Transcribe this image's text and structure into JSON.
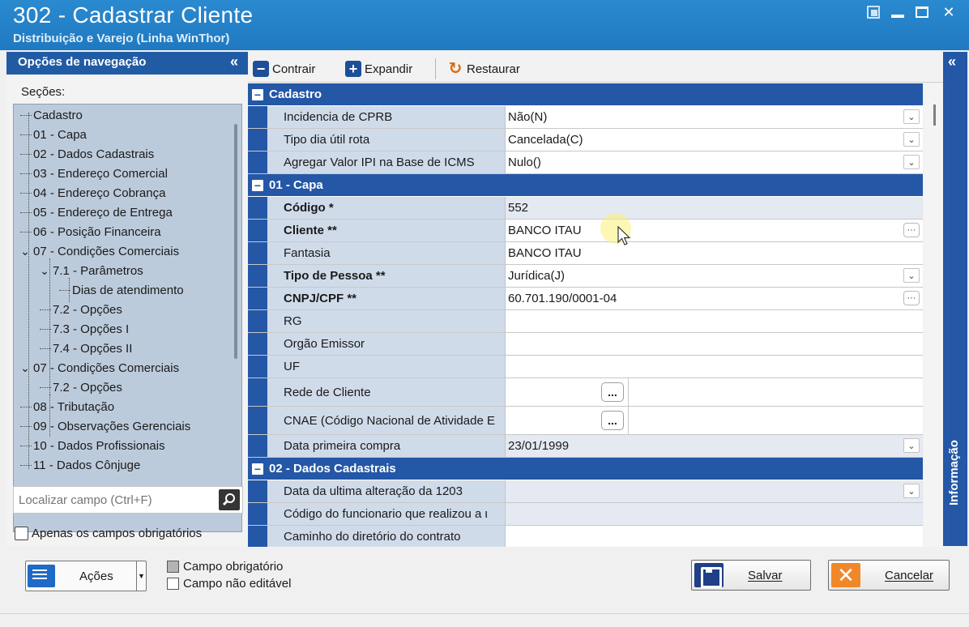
{
  "window": {
    "title": "302 - Cadastrar Cliente",
    "subtitle": "Distribuição e Varejo (Linha WinThor)"
  },
  "nav": {
    "header": "Opções de navegação",
    "sections_label": "Seções:",
    "tree": [
      {
        "label": "Cadastro",
        "level": 0,
        "expander": "none"
      },
      {
        "label": "01 - Capa",
        "level": 0,
        "expander": "none"
      },
      {
        "label": "02 - Dados Cadastrais",
        "level": 0,
        "expander": "none"
      },
      {
        "label": "03 - Endereço Comercial",
        "level": 0,
        "expander": "none"
      },
      {
        "label": "04 - Endereço Cobrança",
        "level": 0,
        "expander": "none"
      },
      {
        "label": "05 - Endereço de Entrega",
        "level": 0,
        "expander": "none"
      },
      {
        "label": "06 - Posição Financeira",
        "level": 0,
        "expander": "none"
      },
      {
        "label": "07 - Condições Comerciais",
        "level": 0,
        "expander": "expanded"
      },
      {
        "label": "7.1 - Parâmetros",
        "level": 1,
        "expander": "expanded"
      },
      {
        "label": "Dias de atendimento",
        "level": 2,
        "expander": "none"
      },
      {
        "label": "7.2 - Opções",
        "level": 1,
        "expander": "none"
      },
      {
        "label": "7.3 - Opções I",
        "level": 1,
        "expander": "none"
      },
      {
        "label": "7.4 - Opções II",
        "level": 1,
        "expander": "none"
      },
      {
        "label": "07 - Condições Comerciais",
        "level": 0,
        "expander": "expanded"
      },
      {
        "label": "7.2 - Opções",
        "level": 1,
        "expander": "none"
      },
      {
        "label": "08 - Tributação",
        "level": 0,
        "expander": "none"
      },
      {
        "label": "09 - Observações Gerenciais",
        "level": 0,
        "expander": "none"
      },
      {
        "label": "10 - Dados Profissionais",
        "level": 0,
        "expander": "none"
      },
      {
        "label": "11 - Dados Cônjuge",
        "level": 0,
        "expander": "none"
      }
    ],
    "search_placeholder": "Localizar campo (Ctrl+F)",
    "only_required_label": "Apenas os campos obrigatórios",
    "only_required_checked": false
  },
  "toolbar": {
    "collapse_label": "Contrair",
    "expand_label": "Expandir",
    "restore_label": "Restaurar"
  },
  "grid": {
    "categories": [
      {
        "title": "Cadastro",
        "rows": [
          {
            "label": "Incidencia de CPRB",
            "value": "Não(N)",
            "bold": false,
            "editor": "dropdown",
            "readonly": false
          },
          {
            "label": "Tipo dia útil rota",
            "value": "Cancelada(C)",
            "bold": false,
            "editor": "dropdown",
            "readonly": false
          },
          {
            "label": "Agregar Valor IPI na Base de ICMS",
            "value": "Nulo()",
            "bold": false,
            "editor": "dropdown",
            "readonly": false
          }
        ]
      },
      {
        "title": "01 - Capa",
        "rows": [
          {
            "label": "Código *",
            "value": "552",
            "bold": true,
            "editor": "none",
            "readonly": true
          },
          {
            "label": "Cliente **",
            "value": "BANCO ITAU",
            "bold": true,
            "editor": "ellipsis",
            "readonly": false
          },
          {
            "label": "Fantasia",
            "value": "BANCO ITAU",
            "bold": false,
            "editor": "none",
            "readonly": false
          },
          {
            "label": "Tipo de Pessoa **",
            "value": "Jurídica(J)",
            "bold": true,
            "editor": "dropdown",
            "readonly": false
          },
          {
            "label": "CNPJ/CPF **",
            "value": "60.701.190/0001-04",
            "bold": true,
            "editor": "ellipsis",
            "readonly": false
          },
          {
            "label": "RG",
            "value": "",
            "bold": false,
            "editor": "none",
            "readonly": false
          },
          {
            "label": "Orgão Emissor",
            "value": "",
            "bold": false,
            "editor": "none",
            "readonly": false
          },
          {
            "label": "UF",
            "value": "",
            "bold": false,
            "editor": "none",
            "readonly": false
          },
          {
            "label": "Rede de Cliente",
            "value": "",
            "bold": false,
            "editor": "lookup",
            "readonly": false
          },
          {
            "label": "CNAE (Código Nacional de Atividade E",
            "value": "",
            "bold": false,
            "editor": "lookup",
            "readonly": false
          },
          {
            "label": "Data primeira compra",
            "value": "23/01/1999",
            "bold": false,
            "editor": "dropdown",
            "readonly": true
          }
        ]
      },
      {
        "title": "02 - Dados Cadastrais",
        "rows": [
          {
            "label": "Data da ultima alteração da 1203",
            "value": "",
            "bold": false,
            "editor": "dropdown",
            "readonly": true
          },
          {
            "label": "Código do funcionario que realizou a ι",
            "value": "",
            "bold": false,
            "editor": "none",
            "readonly": true
          },
          {
            "label": "Caminho do diretório do contrato",
            "value": "",
            "bold": false,
            "editor": "none",
            "readonly": false
          }
        ]
      }
    ]
  },
  "info_panel": {
    "label": "Informação"
  },
  "bottom": {
    "actions_label": "Ações",
    "legend_required": "Campo obrigatório",
    "legend_readonly": "Campo não editável",
    "save_label": "Salvar",
    "cancel_label": "Cancelar"
  },
  "colors": {
    "titlebar": "#2382c8",
    "nav_header": "#215ba4",
    "category_row": "#2457a6",
    "label_cell": "#d0dbea",
    "tree_bg": "#bccbdc",
    "cancel_accent": "#f0882a"
  }
}
